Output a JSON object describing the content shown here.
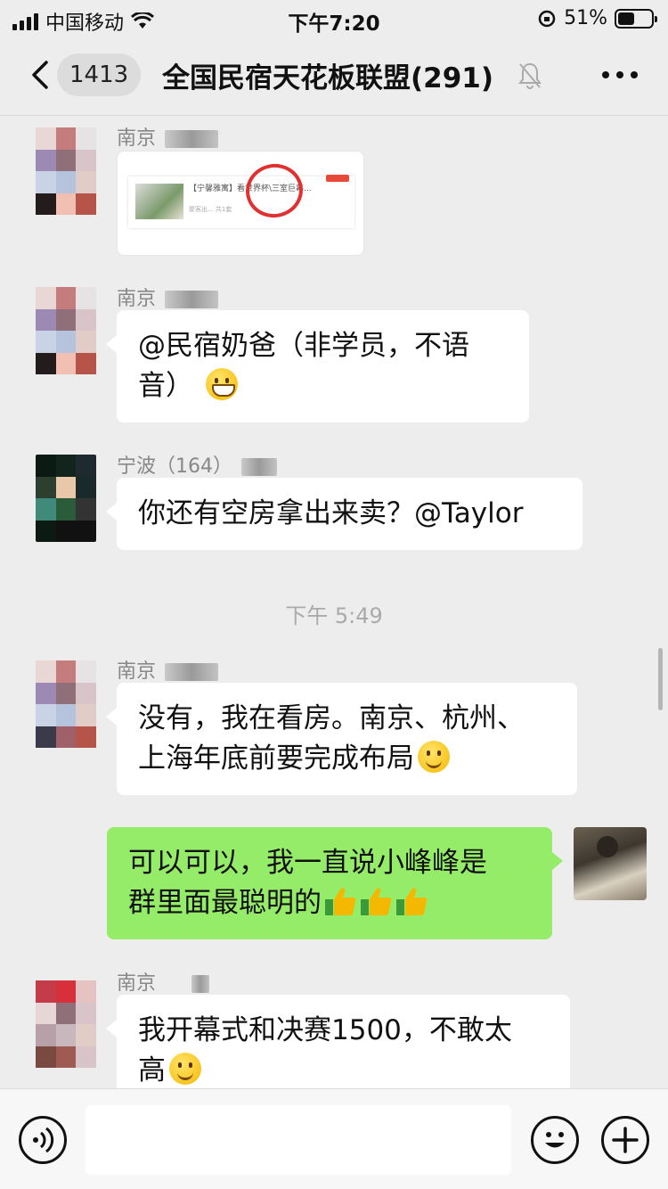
{
  "status_bar": {
    "carrier": "中国移动",
    "time": "下午7:20",
    "battery_percent": "51%",
    "battery_level": 0.51
  },
  "nav": {
    "unread_count": "1413",
    "title": "全国民宿天花板联盟(291)",
    "icons": [
      "back-icon",
      "mute-bell-icon",
      "more-icon"
    ]
  },
  "messages": [
    {
      "sender": "南京",
      "type": "shared-card",
      "card_text": "【宁馨雅寓】看世界杯\\三室巨幕...",
      "card_sub": "聚客出...  共1套"
    },
    {
      "sender": "南京",
      "text": "@民宿奶爸（非学员，不语音）",
      "emoji": "grin-emoji"
    },
    {
      "sender": "宁波（164）",
      "text": "你还有空房拿出来卖？@Taylor"
    },
    {
      "divider": "下午 5:49"
    },
    {
      "sender": "南京",
      "text": "没有，我在看房。南京、杭州、上海年底前要完成布局",
      "emoji": "smile-emoji"
    },
    {
      "sender": "me",
      "text": "可以可以，我一直说小峰峰是群里面最聪明的",
      "emoji": "thumbs-up-emoji x3"
    },
    {
      "sender": "南京",
      "text": "我开幕式和决赛1500，不敢太高",
      "emoji": "smile-emoji"
    }
  ],
  "text": {
    "m1_sender": "南京",
    "m1_card_text": "【宁馨雅寓】看世界杯\\三室巨幕...",
    "m1_card_sub": "聚客出...  共1套",
    "m2_sender": "南京",
    "m2_line1": "@民宿奶爸（非学员，不语",
    "m2_line2": "音）",
    "m3_sender": "宁波（164）",
    "m3_line1": "你还有空房拿出来卖？@Taylor",
    "divider": "下午 5:49",
    "m4_sender": "南京",
    "m4_line1": "没有，我在看房。南京、杭州、",
    "m4_line2": "上海年底前要完成布局",
    "m5_line1": "可以可以，我一直说小峰峰是",
    "m5_line2": "群里面最聪明的",
    "m6_sender": "南京",
    "m6_line1": "我开幕式和决赛1500，不敢太",
    "m6_line2": "高"
  },
  "input_bar": {
    "placeholder": "",
    "icons": [
      "voice-icon",
      "emoji-icon",
      "plus-icon"
    ]
  },
  "colors": {
    "background": "#ededed",
    "my_bubble": "#95ec69",
    "other_bubble": "#ffffff"
  }
}
